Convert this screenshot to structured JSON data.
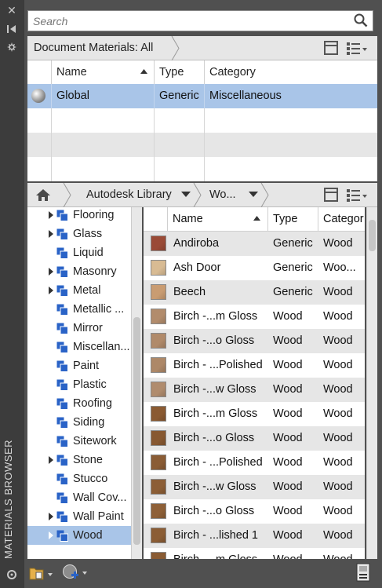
{
  "palette": {
    "title_bg": "#3c3c3c",
    "panel_bg": "#505050",
    "header_bg": "#e6e6e6",
    "selected_row": "#a9c5e8",
    "alt_row": "#e6e6e6",
    "folder_blue": "#2a63c7"
  },
  "panel": {
    "vertical_title": "MATERIALS BROWSER",
    "close_icon": "close-icon",
    "autohide_icon": "autohide-icon",
    "properties_icon": "properties-icon"
  },
  "search": {
    "placeholder": "Search"
  },
  "document": {
    "breadcrumb": "Document Materials: All",
    "headers": {
      "name": "Name",
      "type": "Type",
      "category": "Category"
    },
    "rows": [
      {
        "name": "Global",
        "type": "Generic",
        "category": "Miscellaneous"
      }
    ]
  },
  "library": {
    "home_icon": "home-icon",
    "crumb1": "Autodesk Library",
    "crumb2": "Wo...",
    "tree": [
      {
        "label": "Flooring",
        "expandable": true
      },
      {
        "label": "Glass",
        "expandable": true
      },
      {
        "label": "Liquid",
        "expandable": false
      },
      {
        "label": "Masonry",
        "expandable": true
      },
      {
        "label": "Metal",
        "expandable": true
      },
      {
        "label": "Metallic ...",
        "expandable": false
      },
      {
        "label": "Mirror",
        "expandable": false
      },
      {
        "label": "Miscellan...",
        "expandable": false
      },
      {
        "label": "Paint",
        "expandable": false
      },
      {
        "label": "Plastic",
        "expandable": false
      },
      {
        "label": "Roofing",
        "expandable": false
      },
      {
        "label": "Siding",
        "expandable": false
      },
      {
        "label": "Sitework",
        "expandable": false
      },
      {
        "label": "Stone",
        "expandable": true
      },
      {
        "label": "Stucco",
        "expandable": false
      },
      {
        "label": "Wall Cov...",
        "expandable": false
      },
      {
        "label": "Wall Paint",
        "expandable": true
      },
      {
        "label": "Wood",
        "expandable": true,
        "selected": true
      }
    ],
    "headers": {
      "name": "Name",
      "type": "Type",
      "category": "Categor"
    },
    "materials": [
      {
        "name": "Andiroba",
        "type": "Generic",
        "category": "Wood",
        "swatch": "#9a4a36"
      },
      {
        "name": "Ash Door",
        "type": "Generic",
        "category": "Woo...",
        "swatch": "#d8bb93"
      },
      {
        "name": "Beech",
        "type": "Generic",
        "category": "Wood",
        "swatch": "#c99c72"
      },
      {
        "name": "Birch -...m Gloss",
        "type": "Wood",
        "category": "Wood",
        "swatch": "#b28c6c"
      },
      {
        "name": "Birch -...o Gloss",
        "type": "Wood",
        "category": "Wood",
        "swatch": "#b08a6a"
      },
      {
        "name": "Birch - ...Polished",
        "type": "Wood",
        "category": "Wood",
        "swatch": "#ad8868"
      },
      {
        "name": "Birch -...w Gloss",
        "type": "Wood",
        "category": "Wood",
        "swatch": "#b08c6e"
      },
      {
        "name": "Birch -...m Gloss",
        "type": "Wood",
        "category": "Wood",
        "swatch": "#8a5a32"
      },
      {
        "name": "Birch -...o Gloss",
        "type": "Wood",
        "category": "Wood",
        "swatch": "#875831"
      },
      {
        "name": "Birch - ...Polished",
        "type": "Wood",
        "category": "Wood",
        "swatch": "#8a5c35"
      },
      {
        "name": "Birch -...w Gloss",
        "type": "Wood",
        "category": "Wood",
        "swatch": "#8c5e36"
      },
      {
        "name": "Birch -...o Gloss",
        "type": "Wood",
        "category": "Wood",
        "swatch": "#8e6038"
      },
      {
        "name": "Birch - ...lished 1",
        "type": "Wood",
        "category": "Wood",
        "swatch": "#8b5d35"
      },
      {
        "name": "Birch -...m Gloss",
        "type": "Wood",
        "category": "Wood",
        "swatch": "#8a5c34"
      }
    ]
  },
  "bottombar": {
    "library_icon": "open-library-icon",
    "create_icon": "create-material-icon",
    "editor_icon": "material-editor-icon"
  }
}
